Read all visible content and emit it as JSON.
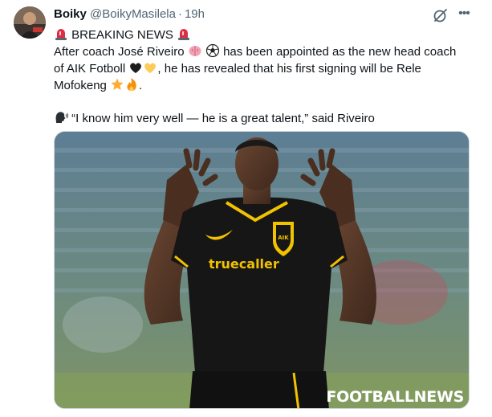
{
  "author": {
    "display_name": "Boiky",
    "handle": "@BoikyMasilela",
    "separator": "·",
    "time": "19h"
  },
  "icons": {
    "grok": "grok-icon",
    "more": "more-icon",
    "siren": "siren-emoji",
    "brain": "brain-emoji",
    "soccer": "soccer-ball-emoji",
    "black_heart": "black-heart-emoji",
    "yellow_heart": "yellow-heart-emoji",
    "star": "star-emoji",
    "fire": "fire-emoji",
    "speaking_head": "speaking-head-emoji"
  },
  "tweet": {
    "line1": "BREAKING NEWS",
    "line2a": "After coach José Riveiro",
    "line2b": "has been appointed as the new head coach",
    "line3a": "of AIK Fotboll",
    "line3b": ", he has revealed that his first signing will be Rele",
    "line4a": "Mofokeng",
    "line4b": ".",
    "quote": "“I know him very well — he is a great talent,” said Riveiro"
  },
  "media": {
    "sponsor_text": "truecaller",
    "watermark": "FOOTBALLNEWS"
  },
  "colors": {
    "text": "#0f1419",
    "muted": "#536471",
    "border": "#cfd9de",
    "jersey": "#161616",
    "jersey_trim": "#f2c200"
  }
}
